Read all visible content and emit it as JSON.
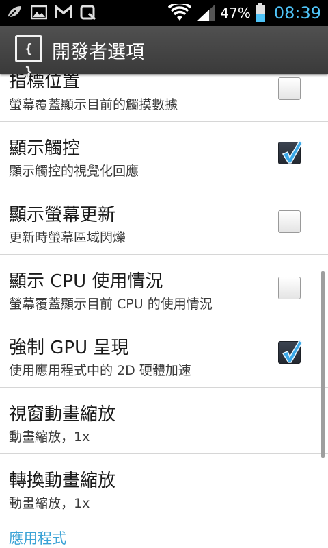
{
  "status_bar": {
    "icons": [
      "leaf-icon",
      "image-icon",
      "gmail-icon",
      "q-icon"
    ],
    "battery_percent": "47%",
    "time": "08:39"
  },
  "action_bar": {
    "icon_glyph": "{ }",
    "title": "開發者選項"
  },
  "settings": [
    {
      "title": "指標位置",
      "summary": "螢幕覆蓋顯示目前的觸摸數據",
      "checked": false
    },
    {
      "title": "顯示觸控",
      "summary": "顯示觸控的視覺化回應",
      "checked": true
    },
    {
      "title": "顯示螢幕更新",
      "summary": "更新時螢幕區域閃爍",
      "checked": false
    },
    {
      "title": "顯示 CPU 使用情況",
      "summary": "螢幕覆蓋顯示目前 CPU 的使用情況",
      "checked": false
    },
    {
      "title": "強制 GPU 呈現",
      "summary": "使用應用程式中的 2D 硬體加速",
      "checked": true
    },
    {
      "title": "視窗動畫縮放",
      "summary": "動畫縮放，1x"
    },
    {
      "title": "轉換動畫縮放",
      "summary": "動畫縮放，1x"
    }
  ],
  "section_header": "應用程式",
  "colors": {
    "accent": "#4fc3f7",
    "section_header": "#3ba3d6",
    "check_mark": "#3aa8e8"
  }
}
